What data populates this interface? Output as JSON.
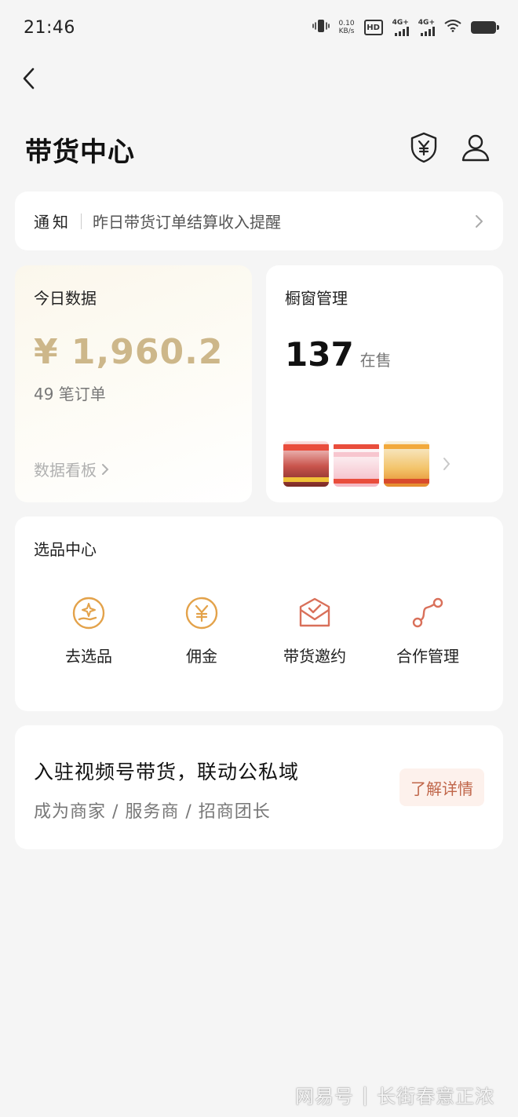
{
  "status_bar": {
    "time": "21:46",
    "net_speed_value": "0.10",
    "net_speed_unit": "KB/s",
    "hd_label": "HD",
    "sim1_label": "4G+",
    "sim2_label": "4G+"
  },
  "header": {
    "title": "带货中心"
  },
  "notice": {
    "tag": "通知",
    "text": "昨日带货订单结算收入提醒"
  },
  "today": {
    "label": "今日数据",
    "amount": "¥ 1,960.2",
    "orders": "49 笔订单",
    "link": "数据看板"
  },
  "window": {
    "label": "橱窗管理",
    "count": "137",
    "unit": "在售"
  },
  "selection": {
    "title": "选品中心",
    "items": [
      {
        "label": "去选品",
        "icon": "hand-sparkle-icon"
      },
      {
        "label": "佣金",
        "icon": "yuan-coin-icon"
      },
      {
        "label": "带货邀约",
        "icon": "envelope-check-icon"
      },
      {
        "label": "合作管理",
        "icon": "connection-icon"
      }
    ]
  },
  "promo": {
    "title": "入驻视频号带货，联动公私域",
    "subtitle": "成为商家 / 服务商 / 招商团长",
    "button": "了解详情"
  },
  "watermark": {
    "source": "网易号",
    "author": "长街春意正浓"
  },
  "colors": {
    "accent_gold": "#cdb78a",
    "icon_orange": "#e3a24a",
    "icon_red": "#d9705a",
    "button_text": "#c0664a",
    "button_bg": "#fdf1ec",
    "background": "#f5f5f5"
  }
}
